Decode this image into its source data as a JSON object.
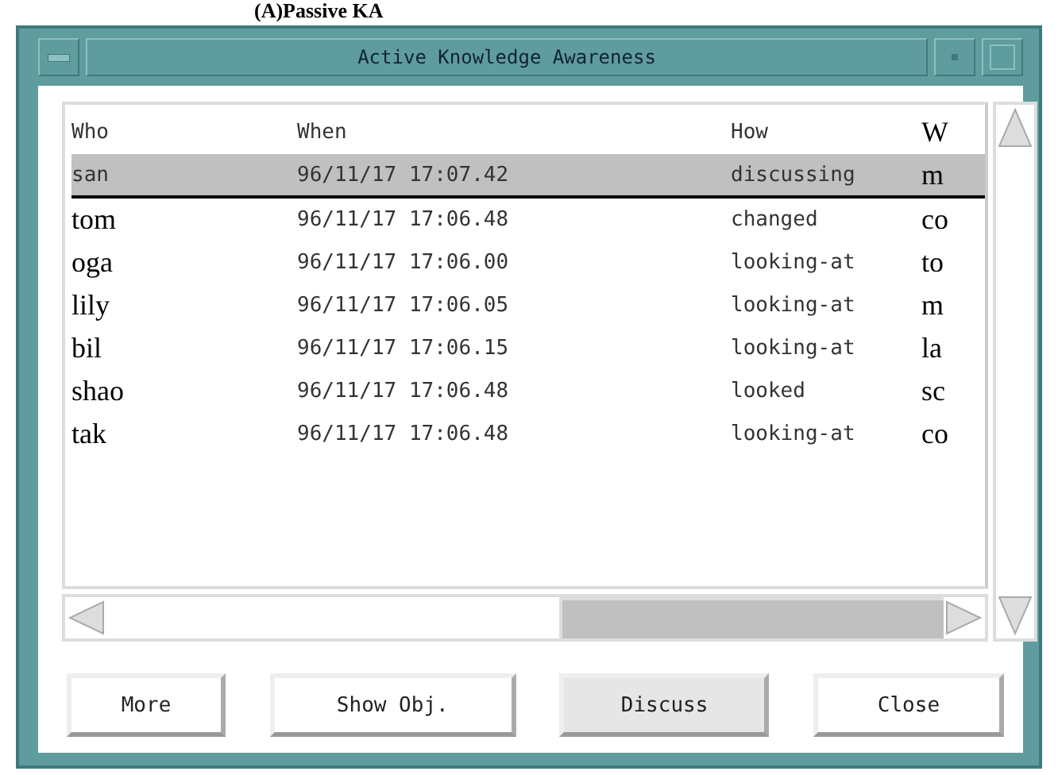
{
  "caption": "(A)Passive KA",
  "window": {
    "title": "Active Knowledge Awareness"
  },
  "table": {
    "columns": [
      "Who",
      "When",
      "How",
      "W"
    ],
    "rows": [
      {
        "cells": [
          "san",
          "96/11/17 17:07.42",
          "discussing",
          "m"
        ],
        "selected": true
      },
      {
        "cells": [
          "tom",
          "96/11/17 17:06.48",
          "changed",
          "co"
        ],
        "selected": false
      },
      {
        "cells": [
          "oga",
          "96/11/17 17:06.00",
          "looking-at",
          "to"
        ],
        "selected": false
      },
      {
        "cells": [
          "lily",
          "96/11/17 17:06.05",
          "looking-at",
          "m"
        ],
        "selected": false
      },
      {
        "cells": [
          "bil",
          "96/11/17 17:06.15",
          "looking-at",
          "la"
        ],
        "selected": false
      },
      {
        "cells": [
          "shao",
          "96/11/17 17:06.48",
          "looked",
          "sc"
        ],
        "selected": false
      },
      {
        "cells": [
          "tak",
          "96/11/17 17:06.48",
          "looking-at",
          "co"
        ],
        "selected": false
      }
    ]
  },
  "buttons": [
    {
      "label": "More",
      "highlighted": false
    },
    {
      "label": "Show Obj.",
      "highlighted": false
    },
    {
      "label": "Discuss",
      "highlighted": true
    },
    {
      "label": "Close",
      "highlighted": false
    }
  ]
}
